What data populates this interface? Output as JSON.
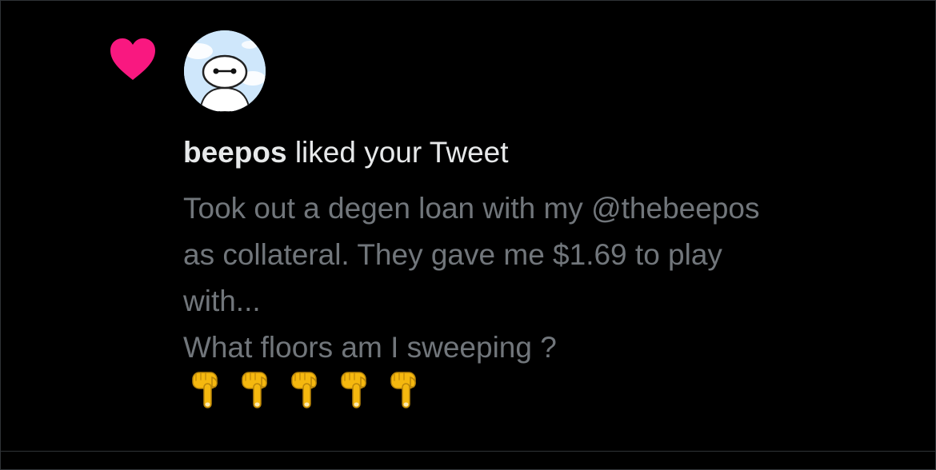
{
  "notification": {
    "type_icon": "heart-icon",
    "heart_color": "#f91880",
    "avatar_icon": "beepos-avatar",
    "username": "beepos",
    "action_text": " liked your Tweet",
    "tweet_lines": [
      "Took out a degen loan with my @thebeepos",
      "as collateral. They gave me $1.69 to play",
      "with...",
      "What floors am I sweeping ?"
    ],
    "emoji_icon": "backhand-index-pointing-down-icon",
    "emoji_count": 5
  },
  "colors": {
    "background": "#000000",
    "primary_text": "#e7e9ea",
    "secondary_text": "#71767b",
    "divider": "#2f3336"
  }
}
